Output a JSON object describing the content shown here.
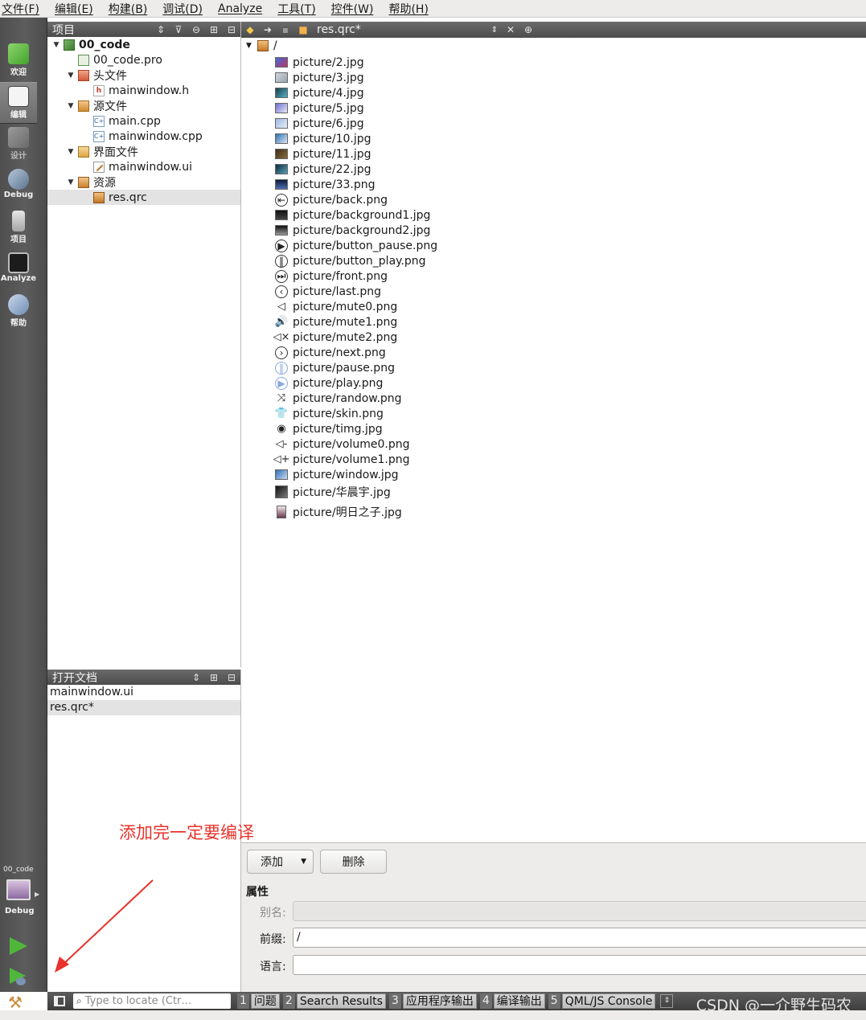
{
  "menu": [
    "文件(F)",
    "编辑(E)",
    "构建(B)",
    "调试(D)",
    "Analyze",
    "工具(T)",
    "控件(W)",
    "帮助(H)"
  ],
  "modes": {
    "welcome": "欢迎",
    "edit": "编辑",
    "design": "设计",
    "debug": "Debug",
    "project": "项目",
    "analyze": "Analyze",
    "help": "帮助"
  },
  "kit": {
    "project": "00_code",
    "config": "Debug"
  },
  "project_pane": {
    "title": "项目",
    "tree": {
      "root": "00_code",
      "pro_file": "00_code.pro",
      "headers_folder": "头文件",
      "header": "mainwindow.h",
      "sources_folder": "源文件",
      "source1": "main.cpp",
      "source2": "mainwindow.cpp",
      "forms_folder": "界面文件",
      "form": "mainwindow.ui",
      "resources_folder": "资源",
      "resource": "res.qrc"
    }
  },
  "docs_pane": {
    "title": "打开文档",
    "docs": [
      "mainwindow.ui",
      "res.qrc*"
    ]
  },
  "editor": {
    "doc_name": "res.qrc*",
    "prefix_root": "/",
    "files": [
      "picture/2.jpg",
      "picture/3.jpg",
      "picture/4.jpg",
      "picture/5.jpg",
      "picture/6.jpg",
      "picture/10.jpg",
      "picture/11.jpg",
      "picture/22.jpg",
      "picture/33.png",
      "picture/back.png",
      "picture/background1.jpg",
      "picture/background2.jpg",
      "picture/button_pause.png",
      "picture/button_play.png",
      "picture/front.png",
      "picture/last.png",
      "picture/mute0.png",
      "picture/mute1.png",
      "picture/mute2.png",
      "picture/next.png",
      "picture/pause.png",
      "picture/play.png",
      "picture/randow.png",
      "picture/skin.png",
      "picture/timg.jpg",
      "picture/volume0.png",
      "picture/volume1.png",
      "picture/window.jpg",
      "picture/华晨宇.jpg",
      "picture/明日之子.jpg"
    ]
  },
  "properties": {
    "add_label": "添加",
    "delete_label": "删除",
    "title": "属性",
    "alias_label": "别名:",
    "alias_value": "",
    "prefix_label": "前缀:",
    "prefix_value": "/",
    "lang_label": "语言:",
    "lang_value": ""
  },
  "annotation": "添加完一定要编译",
  "output": {
    "locator_placeholder": "Type to locate (Ctr…",
    "tabs": [
      {
        "num": "1",
        "name": "问题"
      },
      {
        "num": "2",
        "name": "Search Results"
      },
      {
        "num": "3",
        "name": "应用程序输出"
      },
      {
        "num": "4",
        "name": "编译输出"
      },
      {
        "num": "5",
        "name": "QML/JS Console"
      }
    ]
  },
  "watermark": "CSDN @一介野生码农",
  "colors": {
    "accent_annotation": "#e8322b",
    "run_green": "#4fb83a",
    "mode_bar": "#555555"
  }
}
